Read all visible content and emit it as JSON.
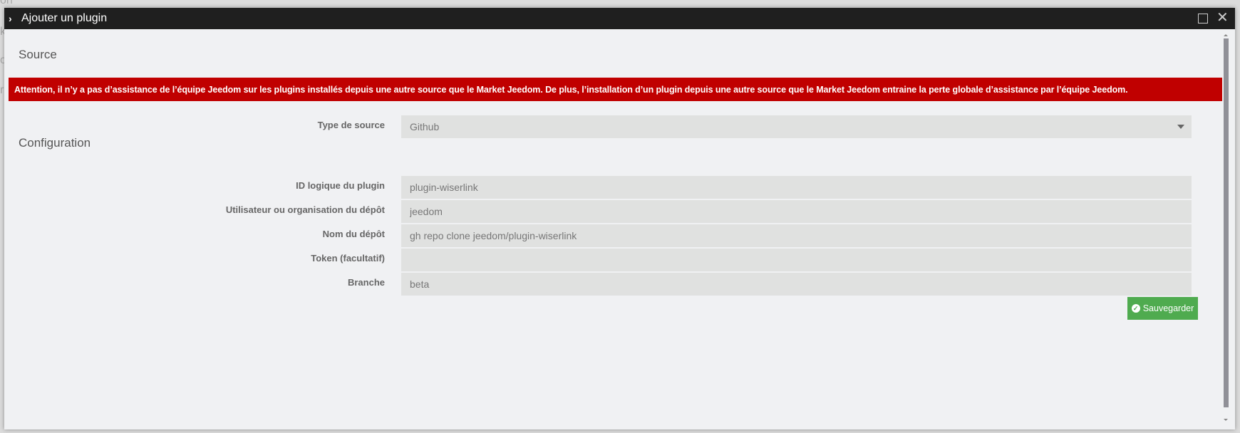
{
  "background_fragments": [
    "on",
    "k",
    "o",
    "r"
  ],
  "dialog": {
    "title": "Ajouter un plugin",
    "source_heading": "Source",
    "warning": "Attention, il n’y a pas d’assistance de l’équipe Jeedom sur les plugins installés depuis une autre source que le Market Jeedom. De plus, l’installation d’un plugin depuis une autre source que le Market Jeedom entraine la perte globale d’assistance par l’équipe Jeedom.",
    "source_type": {
      "label": "Type de source",
      "value": "Github"
    },
    "config_heading": "Configuration",
    "fields": [
      {
        "label": "ID logique du plugin",
        "value": "plugin-wiserlink"
      },
      {
        "label": "Utilisateur ou organisation du dépôt",
        "value": "jeedom"
      },
      {
        "label": "Nom du dépôt",
        "value": "gh repo clone jeedom/plugin-wiserlink"
      },
      {
        "label": "Token (facultatif)",
        "value": ""
      },
      {
        "label": "Branche",
        "value": "beta"
      }
    ],
    "save_label": "Sauvegarder",
    "colors": {
      "warning": "#c00000",
      "save": "#4fab4f",
      "titlebar": "#1f1f1f"
    }
  }
}
